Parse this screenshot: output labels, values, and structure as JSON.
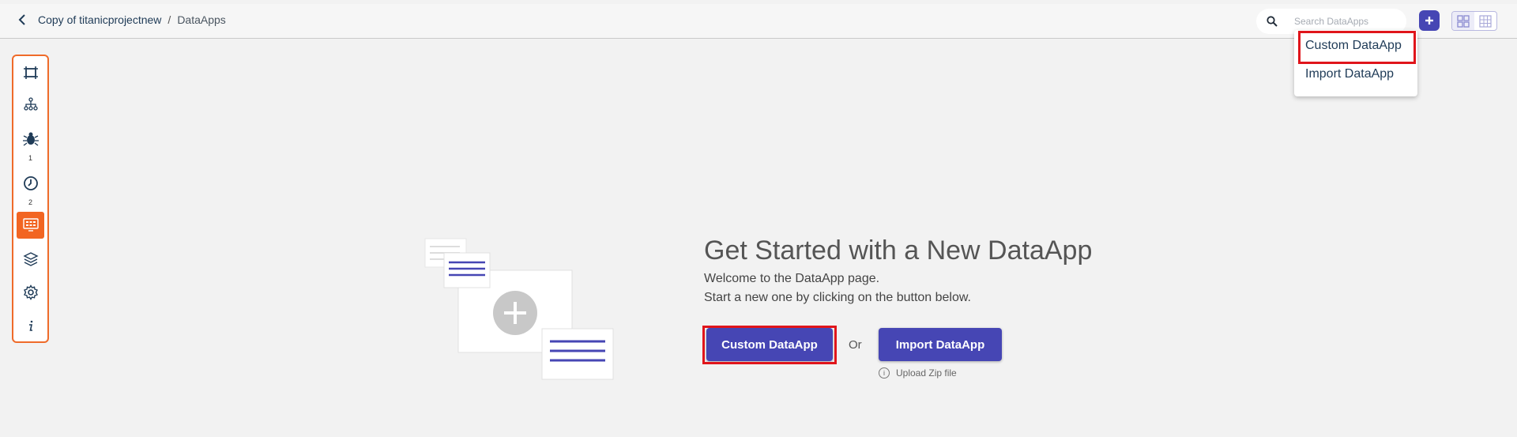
{
  "header": {
    "breadcrumb": {
      "project": "Copy of titanicprojectnew",
      "separator": "/",
      "current": "DataApps"
    },
    "search": {
      "placeholder": "Search DataApps"
    },
    "add_icon": "plus-icon",
    "view_toggle": [
      "grid-view-icon",
      "table-view-icon"
    ]
  },
  "dropdown": {
    "items": [
      "Custom DataApp",
      "Import DataApp"
    ]
  },
  "sidebar": {
    "items": [
      {
        "icon": "canvas-icon"
      },
      {
        "icon": "hierarchy-icon"
      },
      {
        "icon": "bug-icon",
        "count": "1"
      },
      {
        "icon": "clock-icon",
        "count": "2"
      },
      {
        "icon": "dataapp-icon",
        "active": true
      },
      {
        "icon": "layers-icon"
      },
      {
        "icon": "gear-icon"
      },
      {
        "icon": "info-icon"
      }
    ]
  },
  "main": {
    "title": "Get Started with a New DataApp",
    "subtitle": "Welcome to the DataApp page.",
    "subtitle2": "Start a new one by clicking on the button below.",
    "custom_button": "Custom DataApp",
    "or_label": "Or",
    "import_button": "Import DataApp",
    "upload_hint": "Upload Zip file"
  },
  "colors": {
    "primary": "#4646b4",
    "accent": "#f26522",
    "highlight": "#e0151b",
    "background": "#f2f2f2"
  }
}
